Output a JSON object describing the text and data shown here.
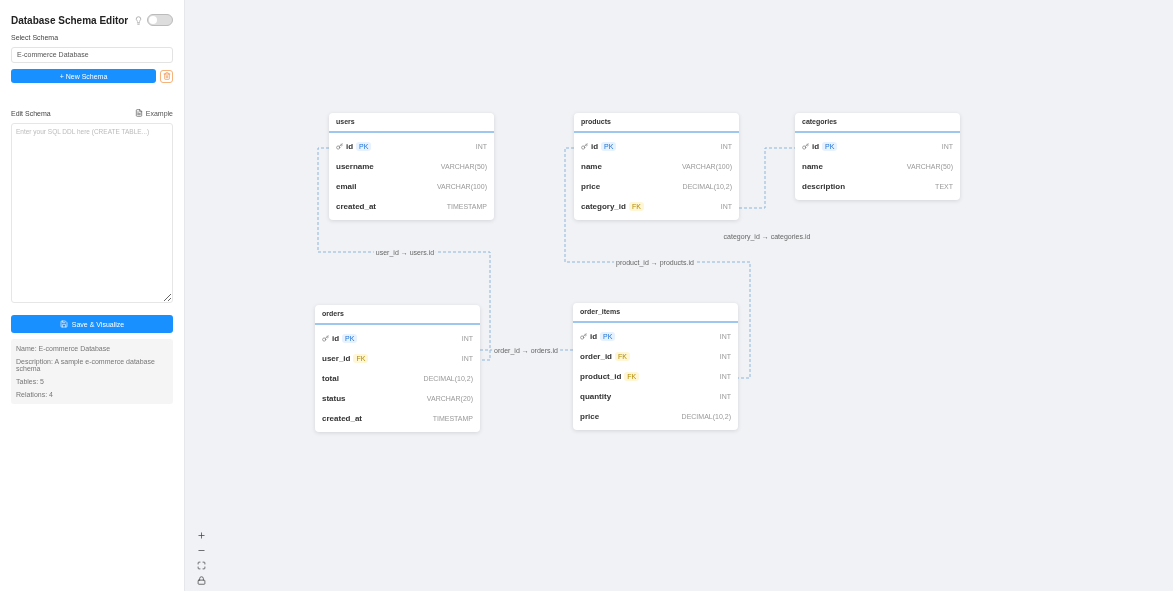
{
  "sidebar": {
    "title": "Database Schema Editor",
    "theme_toggle": {
      "on": false
    },
    "select_label": "Select Schema",
    "select_value": "E-commerce Database",
    "new_button": "+ New Schema",
    "edit_label": "Edit Schema",
    "example_button": "Example",
    "editor_placeholder": "Enter your SQL DDL here (CREATE TABLE...)",
    "save_button": "Save & Visualize",
    "info": [
      "Name: E-commerce Database",
      "Description: A sample e-commerce database schema",
      "Tables: 5",
      "Relations: 4"
    ]
  },
  "tables": [
    {
      "name": "users",
      "columns": [
        {
          "name": "id",
          "badge": "PK",
          "kind": "pk",
          "type": "INT"
        },
        {
          "name": "username",
          "type": "VARCHAR(50)"
        },
        {
          "name": "email",
          "type": "VARCHAR(100)"
        },
        {
          "name": "created_at",
          "type": "TIMESTAMP"
        }
      ]
    },
    {
      "name": "products",
      "columns": [
        {
          "name": "id",
          "badge": "PK",
          "kind": "pk",
          "type": "INT"
        },
        {
          "name": "name",
          "type": "VARCHAR(100)"
        },
        {
          "name": "price",
          "type": "DECIMAL(10,2)"
        },
        {
          "name": "category_id",
          "badge": "FK",
          "kind": "fk",
          "type": "INT"
        }
      ]
    },
    {
      "name": "categories",
      "columns": [
        {
          "name": "id",
          "badge": "PK",
          "kind": "pk",
          "type": "INT"
        },
        {
          "name": "name",
          "type": "VARCHAR(50)"
        },
        {
          "name": "description",
          "type": "TEXT"
        }
      ]
    },
    {
      "name": "orders",
      "columns": [
        {
          "name": "id",
          "badge": "PK",
          "kind": "pk",
          "type": "INT"
        },
        {
          "name": "user_id",
          "badge": "FK",
          "kind": "fk",
          "type": "INT"
        },
        {
          "name": "total",
          "type": "DECIMAL(10,2)"
        },
        {
          "name": "status",
          "type": "VARCHAR(20)"
        },
        {
          "name": "created_at",
          "type": "TIMESTAMP"
        }
      ]
    },
    {
      "name": "order_items",
      "columns": [
        {
          "name": "id",
          "badge": "PK",
          "kind": "pk",
          "type": "INT"
        },
        {
          "name": "order_id",
          "badge": "FK",
          "kind": "fk",
          "type": "INT"
        },
        {
          "name": "product_id",
          "badge": "FK",
          "kind": "fk",
          "type": "INT"
        },
        {
          "name": "quantity",
          "type": "INT"
        },
        {
          "name": "price",
          "type": "DECIMAL(10,2)"
        }
      ]
    }
  ],
  "relations": [
    {
      "label": "user_id → users.id"
    },
    {
      "label": "order_id → orders.id"
    },
    {
      "label": "product_id → products.id"
    },
    {
      "label": "category_id → categories.id"
    }
  ]
}
